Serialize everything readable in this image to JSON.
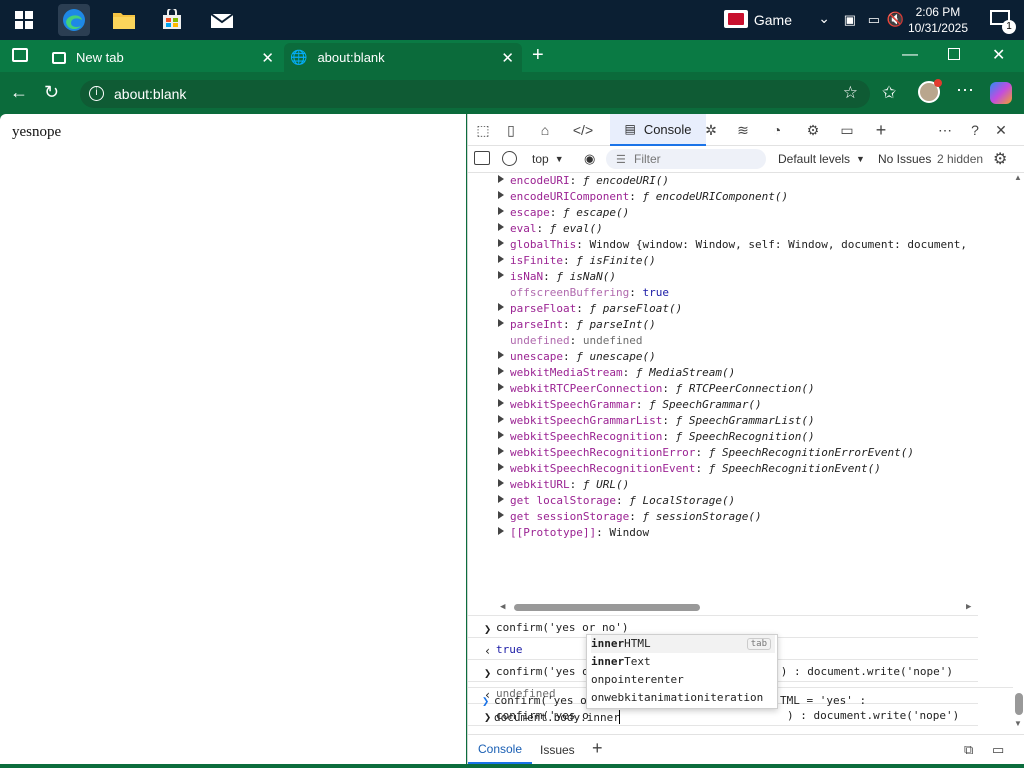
{
  "taskbar": {
    "game_label": "Game",
    "time": "2:06 PM",
    "date": "10/31/2025",
    "notification_count": "1"
  },
  "tabs": [
    {
      "label": "New tab"
    },
    {
      "label": "about:blank"
    }
  ],
  "address": {
    "url": "about:blank"
  },
  "page": {
    "text": "yesnope"
  },
  "devtools": {
    "console_tab": "Console",
    "context": "top",
    "filter_placeholder": "Filter",
    "levels": "Default levels",
    "issues": "No Issues",
    "hidden": "2 hidden",
    "drawer_console": "Console",
    "drawer_issues": "Issues"
  },
  "props": [
    {
      "key": "encodeURI",
      "sep": ": ",
      "f": "ƒ ",
      "val": "encodeURI()",
      "arrow": true
    },
    {
      "key": "encodeURIComponent",
      "sep": ": ",
      "f": "ƒ ",
      "val": "encodeURIComponent()",
      "arrow": true
    },
    {
      "key": "escape",
      "sep": ": ",
      "f": "ƒ ",
      "val": "escape()",
      "arrow": true
    },
    {
      "key": "eval",
      "sep": ": ",
      "f": "ƒ ",
      "val": "eval()",
      "arrow": true
    },
    {
      "key": "globalThis",
      "sep": ": ",
      "f": "",
      "val": "Window {window: Window, self: Window, document: document,",
      "arrow": true,
      "plain": true
    },
    {
      "key": "isFinite",
      "sep": ": ",
      "f": "ƒ ",
      "val": "isFinite()",
      "arrow": true
    },
    {
      "key": "isNaN",
      "sep": ": ",
      "f": "ƒ ",
      "val": "isNaN()",
      "arrow": true
    },
    {
      "key": "offscreenBuffering",
      "sep": ": ",
      "f": "",
      "val": "true",
      "arrow": false,
      "bool": true
    },
    {
      "key": "parseFloat",
      "sep": ": ",
      "f": "ƒ ",
      "val": "parseFloat()",
      "arrow": true
    },
    {
      "key": "parseInt",
      "sep": ": ",
      "f": "ƒ ",
      "val": "parseInt()",
      "arrow": true
    },
    {
      "key": "undefined",
      "sep": ": ",
      "f": "",
      "val": "undefined",
      "arrow": false,
      "undef": true
    },
    {
      "key": "unescape",
      "sep": ": ",
      "f": "ƒ ",
      "val": "unescape()",
      "arrow": true
    },
    {
      "key": "webkitMediaStream",
      "sep": ": ",
      "f": "ƒ ",
      "val": "MediaStream()",
      "arrow": true
    },
    {
      "key": "webkitRTCPeerConnection",
      "sep": ": ",
      "f": "ƒ ",
      "val": "RTCPeerConnection()",
      "arrow": true
    },
    {
      "key": "webkitSpeechGrammar",
      "sep": ": ",
      "f": "ƒ ",
      "val": "SpeechGrammar()",
      "arrow": true
    },
    {
      "key": "webkitSpeechGrammarList",
      "sep": ": ",
      "f": "ƒ ",
      "val": "SpeechGrammarList()",
      "arrow": true
    },
    {
      "key": "webkitSpeechRecognition",
      "sep": ": ",
      "f": "ƒ ",
      "val": "SpeechRecognition()",
      "arrow": true
    },
    {
      "key": "webkitSpeechRecognitionError",
      "sep": ": ",
      "f": "ƒ ",
      "val": "SpeechRecognitionErrorEvent()",
      "arrow": true
    },
    {
      "key": "webkitSpeechRecognitionEvent",
      "sep": ": ",
      "f": "ƒ ",
      "val": "SpeechRecognitionEvent()",
      "arrow": true
    },
    {
      "key": "webkitURL",
      "sep": ": ",
      "f": "ƒ ",
      "val": "URL()",
      "arrow": true
    },
    {
      "key": "get localStorage",
      "sep": ": ",
      "f": "ƒ ",
      "val": "LocalStorage()",
      "arrow": true
    },
    {
      "key": "get sessionStorage",
      "sep": ": ",
      "f": "ƒ ",
      "val": "sessionStorage()",
      "arrow": true
    },
    {
      "key": "[[Prototype]]",
      "sep": ": ",
      "f": "",
      "val": "Window",
      "arrow": true,
      "plain": true
    }
  ],
  "console_lines": {
    "c1": "confirm('yes or no')",
    "r1": "true",
    "c2a": "confirm('yes or no') ? document.write('yes') : document.write('nope')",
    "r2": "undefined",
    "c3a": "confirm('yes o",
    "c3b": ") : document.write('nope')",
    "r3": "undefined",
    "c4a": "confirm('yes o",
    "c4b": "TML = 'yes' :",
    "c4c": "document.body.inner"
  },
  "autocomplete": [
    {
      "bold": "inner",
      "rest": "HTML",
      "hint": "tab"
    },
    {
      "bold": "inner",
      "rest": "Text",
      "hint": ""
    },
    {
      "bold": "",
      "rest": "onpointerenter",
      "hint": ""
    },
    {
      "bold": "",
      "rest": "onwebkitanimationiteration",
      "hint": ""
    }
  ]
}
